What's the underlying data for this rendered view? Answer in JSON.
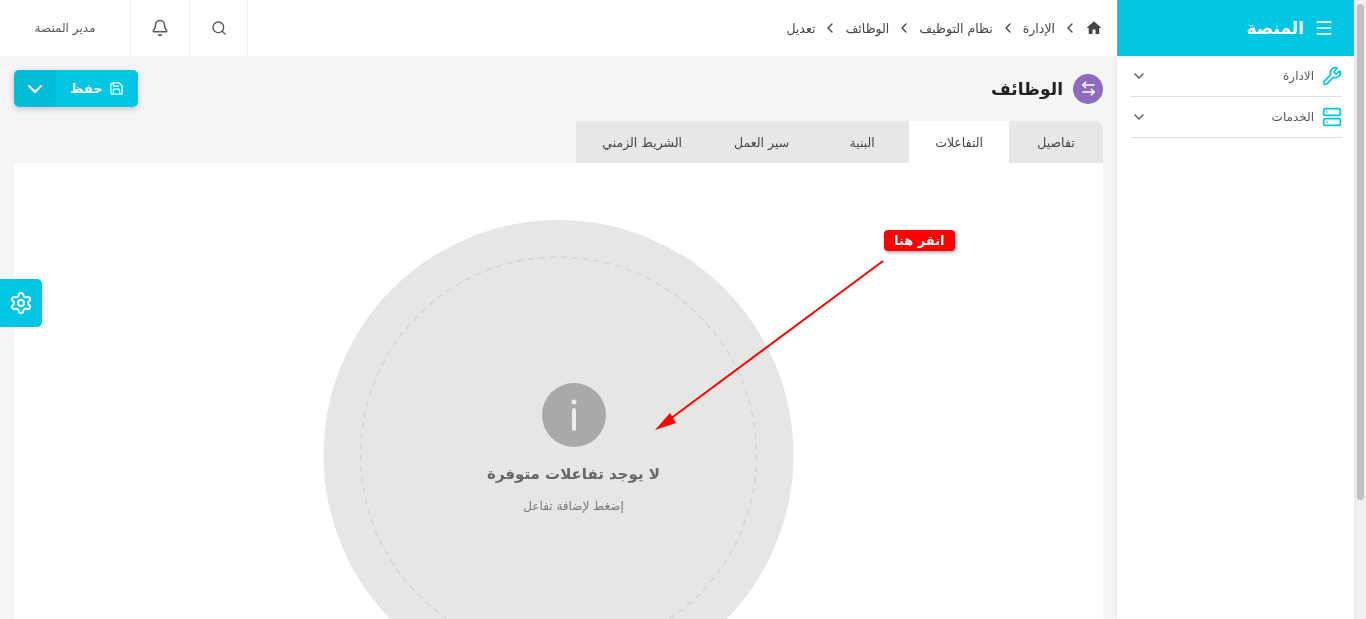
{
  "sidebar": {
    "title": "المنصة",
    "items": [
      {
        "label": "الادارة",
        "kind": "tools",
        "expanded": false
      },
      {
        "label": "الخدمات",
        "kind": "server",
        "expanded": false
      }
    ]
  },
  "header": {
    "breadcrumb": [
      "الإدارة",
      "نظام التوظيف",
      "الوظائف",
      "تعديل"
    ],
    "user": "مدير المنصة"
  },
  "page": {
    "title": "الوظائف",
    "save_button": "حفظ"
  },
  "tabs": [
    {
      "label": "تفاصيل",
      "selected": false
    },
    {
      "label": "التفاعلات",
      "selected": true
    },
    {
      "label": "البنية",
      "selected": false
    },
    {
      "label": "سير العمل",
      "selected": false
    },
    {
      "label": "الشريط الزمني",
      "selected": false
    }
  ],
  "empty_state": {
    "title": "لا يوجد تفاعلات متوفرة",
    "hint": "إضغط لإضافة تفاعل"
  },
  "annotation": {
    "label": "انقر هنا"
  }
}
